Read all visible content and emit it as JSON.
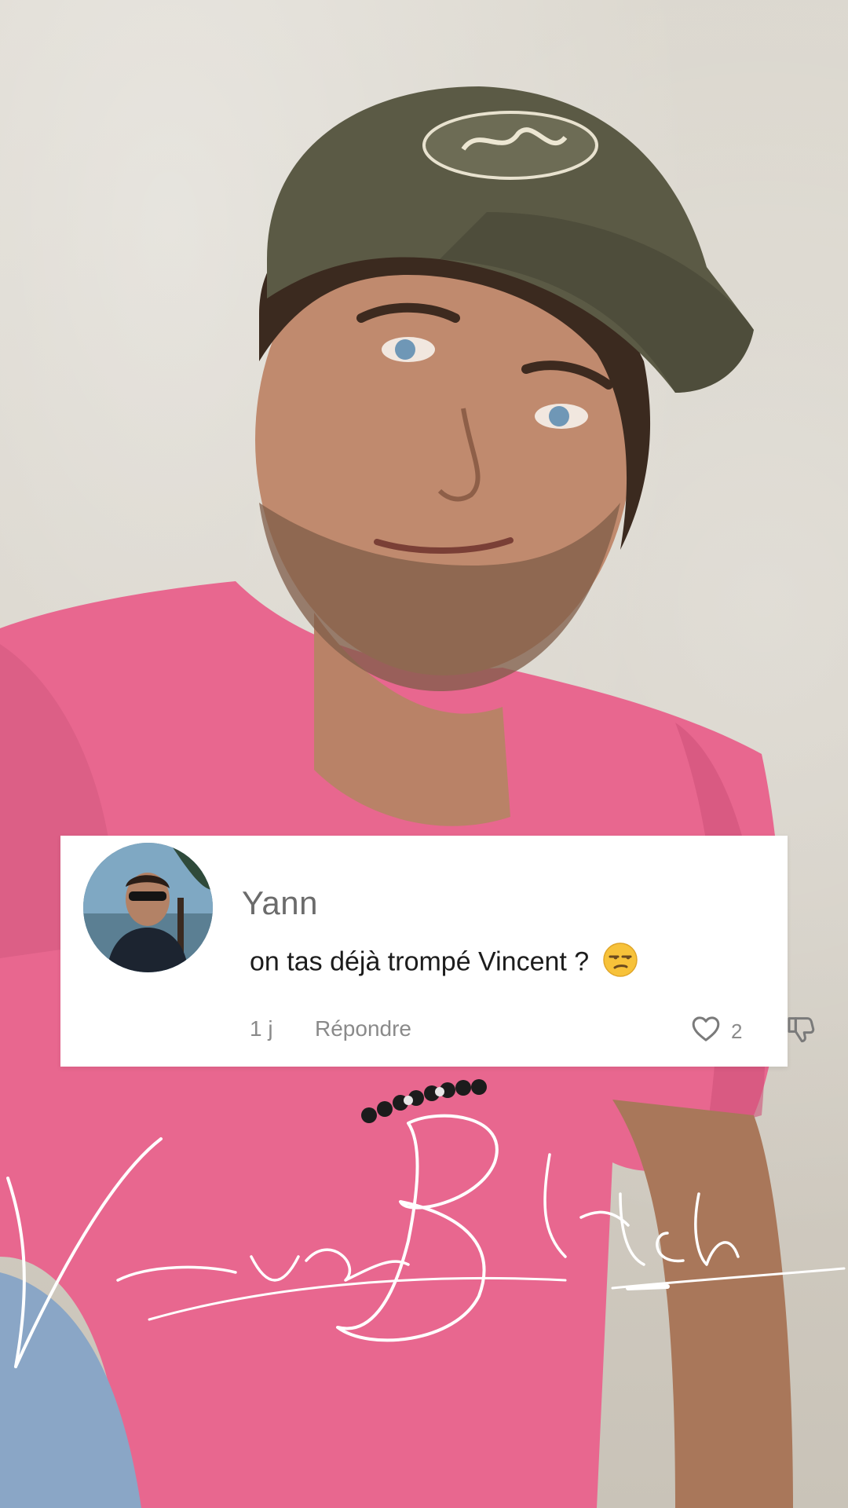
{
  "comment": {
    "username": "Yann",
    "text": "on tas déjà trompé Vincent ?",
    "time": "1 j",
    "reply_label": "Répondre",
    "like_count": "2",
    "icons": {
      "avatar": "user-avatar",
      "emoji": "unamused-face-emoji",
      "like": "heart-icon",
      "dislike": "thumbs-down-icon"
    }
  },
  "watermark": {
    "text": "Vincent Blitch"
  },
  "colors": {
    "shirt": "#e8678f",
    "cap": "#5b5a45",
    "card_bg": "#ffffff",
    "muted_text": "#8a8a8a",
    "emoji": "#f7c23a"
  }
}
